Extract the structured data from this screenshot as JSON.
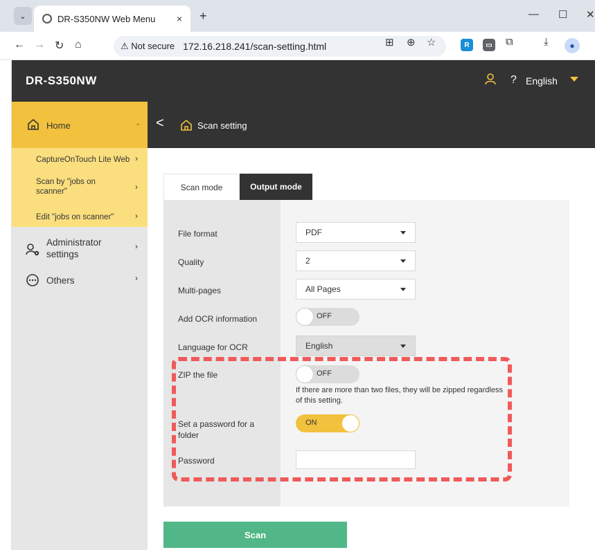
{
  "browser": {
    "tab_title": "DR-S350NW Web Menu",
    "tab_close": "×",
    "new_tab": "+",
    "not_secure": "⚠ Not secure",
    "url": "172.16.218.241/scan-setting.html",
    "window_controls": [
      "—",
      "☐",
      "✕"
    ]
  },
  "header": {
    "brand": "DR-S350NW",
    "help": "?",
    "language": "English"
  },
  "sidebar": {
    "home": "Home",
    "sub_items": [
      {
        "label": "CaptureOnTouch Lite Web"
      },
      {
        "label": "Scan by \"jobs on scanner\""
      },
      {
        "label": "Edit \"jobs on scanner\""
      }
    ],
    "items": [
      {
        "label": "Administrator settings"
      },
      {
        "label": "Others"
      }
    ]
  },
  "subheader": {
    "back": "<",
    "title": "Scan setting"
  },
  "tabs": {
    "scan_mode": "Scan mode",
    "output_mode": "Output mode"
  },
  "form": {
    "file_format": {
      "label": "File format",
      "value": "PDF"
    },
    "quality": {
      "label": "Quality",
      "value": "2"
    },
    "multi_pages": {
      "label": "Multi-pages",
      "value": "All Pages"
    },
    "add_ocr": {
      "label": "Add OCR information",
      "state": "OFF"
    },
    "ocr_language": {
      "label": "Language for OCR",
      "value": "English"
    },
    "zip": {
      "label": "ZIP the file",
      "state": "OFF",
      "note": "If there are more than two files, they will be zipped regardless of this setting."
    },
    "folder_password": {
      "label": "Set a password for a folder",
      "state": "ON"
    },
    "password": {
      "label": "Password",
      "value": ""
    }
  },
  "actions": {
    "scan": "Scan"
  },
  "colors": {
    "header_bg": "#333333",
    "accent_yellow": "#f2c13d",
    "scan_button": "#52b788",
    "highlight_dash": "#f05a5a"
  }
}
